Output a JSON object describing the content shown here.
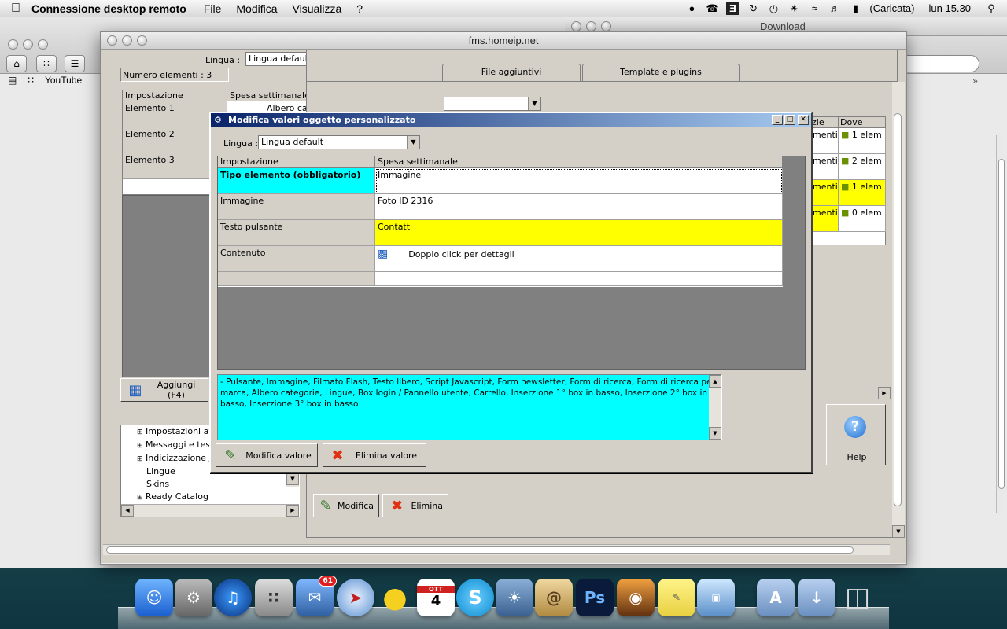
{
  "menubar": {
    "app_name": "Connessione desktop remoto",
    "menus": [
      "File",
      "Modifica",
      "Visualizza",
      "?"
    ],
    "battery": "(Caricata)",
    "clock": "lun 15.30"
  },
  "safari": {
    "bookmark": "YouTube",
    "download_title": "Download"
  },
  "window": {
    "title": "fms.homeip.net"
  },
  "left_panel": {
    "lingua_label": "Lingua :",
    "lingua_value": "Lingua default",
    "numero_elementi": "Numero elementi : 3",
    "grid_headers": [
      "Impostazione",
      "Spesa settimanale"
    ],
    "rows": [
      "Elemento 1",
      "Elemento 2",
      "Elemento 3"
    ],
    "row1_value": "Albero categorie",
    "add_button": "Aggiungi (F4)",
    "tree_items": [
      "Impostazioni ava",
      "Messaggi e testi",
      "Indicizzazione / S",
      "Lingue",
      "Skins",
      "Ready Catalog"
    ]
  },
  "tabs": [
    "File aggiuntivi",
    "Template e plugins"
  ],
  "right_grid": {
    "headers": [
      "zie",
      "Dove puoi t"
    ],
    "rows": [
      {
        "a": "menti",
        "b": "1 elem"
      },
      {
        "a": "menti",
        "b": "2 elem"
      },
      {
        "a": "menti",
        "b": "1 elem"
      },
      {
        "a": "menti",
        "b": "0 elem"
      }
    ]
  },
  "help_label": "Help",
  "bottom_buttons": {
    "modifica": "Modifica",
    "elimina": "Elimina"
  },
  "dialog": {
    "title": "Modifica valori oggetto personalizzato",
    "lingua_label": "Lingua :",
    "lingua_value": "Lingua default",
    "headers": [
      "Impostazione",
      "Spesa settimanale"
    ],
    "rows": [
      {
        "label": "Tipo elemento (obbligatorio)",
        "value": "Immagine"
      },
      {
        "label": "Immagine",
        "value": "Foto ID 2316"
      },
      {
        "label": "Testo pulsante",
        "value": "Contatti"
      },
      {
        "label": "Contenuto",
        "value": "Doppio click per dettagli"
      }
    ],
    "hint": "- Pulsante, Immagine, Filmato Flash, Testo libero, Script Javascript, Form newsletter, Form di ricerca, Form di ricerca per marca, Albero categorie, Lingue, Box login / Pannello utente, Carrello, Inserzione 1° box in basso, Inserzione 2° box in basso, Inserzione 3° box in basso",
    "modifica_valore": "Modifica valore",
    "elimina_valore": "Elimina valore"
  },
  "dock": {
    "mail_badge": "61",
    "calendar_day": "4",
    "calendar_month": "OTT"
  },
  "colors": {
    "cyan": "#00ffff",
    "yellow": "#ffff00",
    "caption": "#0a246a"
  }
}
